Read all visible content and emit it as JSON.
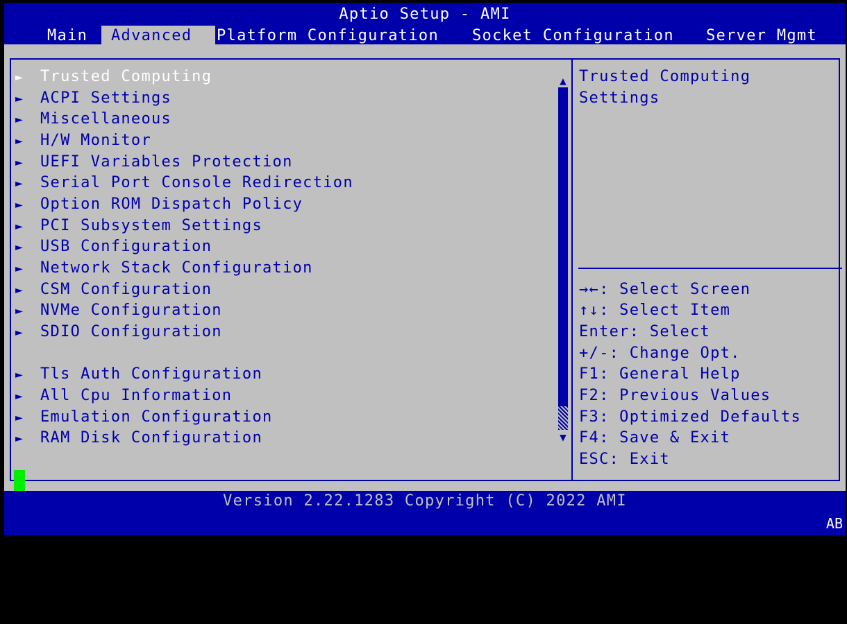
{
  "app": {
    "title": "Aptio Setup - AMI"
  },
  "tabs": [
    {
      "label": "Main"
    },
    {
      "label": "Advanced",
      "active": true
    },
    {
      "label": "Platform Configuration"
    },
    {
      "label": "Socket Configuration"
    },
    {
      "label": "Server Mgmt"
    }
  ],
  "menu": {
    "items": [
      {
        "label": "Trusted Computing",
        "selected": true
      },
      {
        "label": "ACPI Settings"
      },
      {
        "label": "Miscellaneous"
      },
      {
        "label": "H/W Monitor"
      },
      {
        "label": "UEFI Variables Protection"
      },
      {
        "label": "Serial Port Console Redirection"
      },
      {
        "label": "Option ROM Dispatch Policy"
      },
      {
        "label": "PCI Subsystem Settings"
      },
      {
        "label": "USB Configuration"
      },
      {
        "label": "Network Stack Configuration"
      },
      {
        "label": "CSM Configuration"
      },
      {
        "label": "NVMe Configuration"
      },
      {
        "label": "SDIO Configuration"
      },
      {
        "label": "Tls Auth Configuration"
      },
      {
        "label": "All Cpu Information"
      },
      {
        "label": "Emulation Configuration"
      },
      {
        "label": "RAM Disk Configuration"
      }
    ]
  },
  "help": {
    "lines": [
      "Trusted Computing",
      "Settings"
    ]
  },
  "keys": [
    "→←: Select Screen",
    "↑↓: Select Item",
    "Enter: Select",
    "+/-: Change Opt.",
    "F1: General Help",
    "F2: Previous Values",
    "F3: Optimized Defaults",
    "F4: Save & Exit",
    "ESC: Exit"
  ],
  "footer": {
    "version": "Version 2.22.1283 Copyright (C) 2022 AMI",
    "code": "AB"
  },
  "colors": {
    "blue": "#0000aa",
    "gray": "#c0c0c0",
    "white": "#ffffff",
    "cursor": "#00ee00"
  }
}
